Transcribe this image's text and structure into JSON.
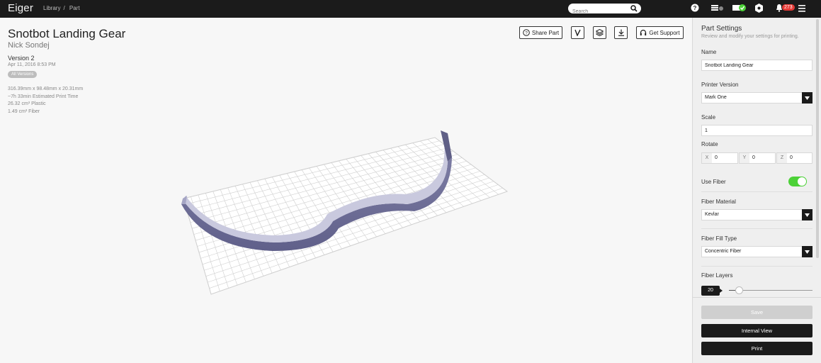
{
  "app": {
    "brand": "Eiger"
  },
  "breadcrumb": [
    "Library",
    "Part"
  ],
  "search": {
    "placeholder": "Search",
    "value": ""
  },
  "notifications": {
    "count": "273"
  },
  "part": {
    "title": "Snotbot Landing Gear",
    "author": "Nick Sondej",
    "version": "Version 2",
    "date": "Apr 11, 2016 8:53 PM",
    "all_versions": "All Versions",
    "stats": [
      "316.39mm x 98.48mm x 20.31mm",
      "~7h 33min Estimated Print Time",
      "26.32 cm³ Plastic",
      "1.49 cm³ Fiber"
    ]
  },
  "toolbar": {
    "share": "Share Part",
    "support": "Get Support",
    "icons": [
      "question-icon",
      "version-icon",
      "layers-icon",
      "download-icon",
      "headset-icon"
    ]
  },
  "settings": {
    "title": "Part Settings",
    "subtitle": "Review and modify your settings for printing.",
    "name_label": "Name",
    "name_value": "Snotbot Landing Gear",
    "printer_label": "Printer Version",
    "printer_value": "Mark One",
    "scale_label": "Scale",
    "scale_value": "1",
    "rotate_label": "Rotate",
    "rotate": [
      {
        "axis": "X",
        "value": "0"
      },
      {
        "axis": "Y",
        "value": "0"
      },
      {
        "axis": "Z",
        "value": "0"
      }
    ],
    "use_fiber_label": "Use Fiber",
    "use_fiber": true,
    "fiber_material_label": "Fiber Material",
    "fiber_material_value": "Kevlar",
    "fiber_fill_label": "Fiber Fill Type",
    "fiber_fill_value": "Concentric Fiber",
    "fiber_layers_label": "Fiber Layers",
    "fiber_layers_value": "20",
    "fiber_layers_fraction": 0.12,
    "save": "Save",
    "internal_view": "Internal View",
    "print": "Print"
  },
  "colors": {
    "topbar": "#1b1b1b",
    "accent_toggle": "#4cd137",
    "badge": "#e53935",
    "part_fill": "#9b9bbf"
  }
}
